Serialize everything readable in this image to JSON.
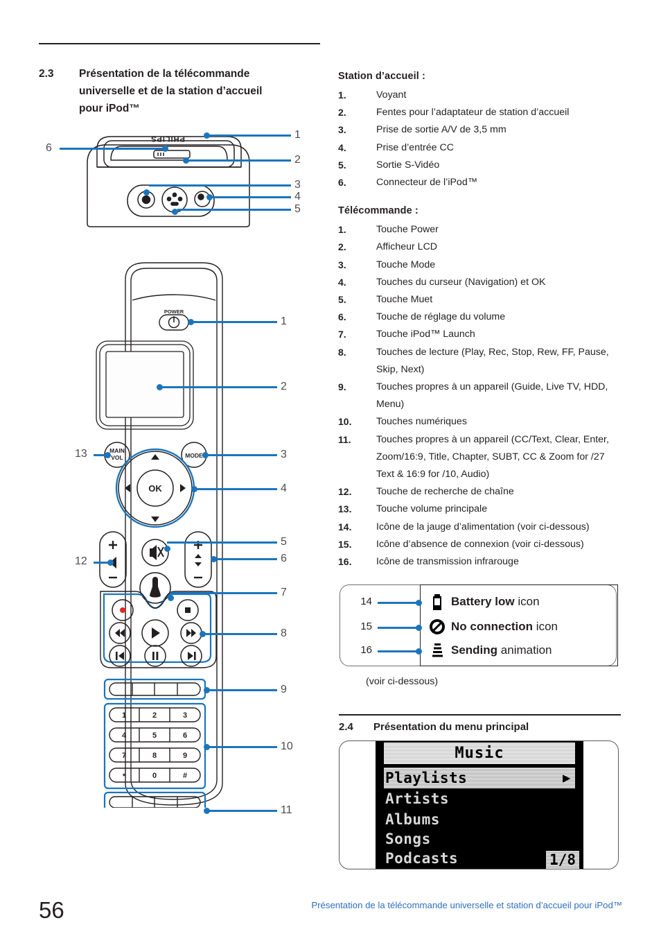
{
  "section_23": {
    "number": "2.3",
    "title_line1": "Présentation de la télécommande",
    "title_line2": "universelle et de la station d’accueil",
    "title_line3": "pour iPod™"
  },
  "dock_list": {
    "heading": "Station d’accueil :",
    "items": [
      {
        "n": "1.",
        "text": "Voyant"
      },
      {
        "n": "2.",
        "text": "Fentes pour l’adaptateur de station d’accueil"
      },
      {
        "n": "3.",
        "text": "Prise de sortie A/V de 3,5 mm"
      },
      {
        "n": "4.",
        "text": "Prise d’entrée CC"
      },
      {
        "n": "5.",
        "text": "Sortie S-Vidéo"
      },
      {
        "n": "6.",
        "text": "Connecteur de l’iPod™"
      }
    ]
  },
  "remote_list": {
    "heading": "Télécommande :",
    "items": [
      {
        "n": "1.",
        "text": "Touche Power"
      },
      {
        "n": "2.",
        "text": "Afficheur LCD"
      },
      {
        "n": "3.",
        "text": "Touche Mode"
      },
      {
        "n": "4.",
        "text": "Touches du curseur (Navigation) et OK"
      },
      {
        "n": "5.",
        "text": "Touche Muet"
      },
      {
        "n": "6.",
        "text": "Touche de réglage du volume"
      },
      {
        "n": "7.",
        "text": "Touche iPod™ Launch"
      },
      {
        "n": "8.",
        "text": "Touches de lecture (Play, Rec, Stop, Rew, FF, Pause, Skip, Next)"
      },
      {
        "n": "9.",
        "text": "Touches propres à un appareil (Guide, Live TV, HDD, Menu)"
      },
      {
        "n": "10.",
        "text": "Touches numériques"
      },
      {
        "n": "11.",
        "text": "Touches propres à un appareil (CC/Text, Clear, Enter, Zoom/16:9, Title, Chapter, SUBT, CC & Zoom for /27 Text & 16:9 for /10, Audio)"
      },
      {
        "n": "12.",
        "text": "Touche de recherche de chaîne"
      },
      {
        "n": "13.",
        "text": "Touche volume principale"
      },
      {
        "n": "14.",
        "text": "Icône de la jauge d’alimentation (voir ci-dessous)"
      },
      {
        "n": "15.",
        "text": "Icône d’absence de connexion (voir ci-dessous)"
      },
      {
        "n": "16.",
        "text": "Icône de transmission infrarouge"
      }
    ]
  },
  "legend": {
    "rows": [
      {
        "num": "14",
        "icon": "battery-low-icon",
        "bold": "Battery low",
        "rest": " icon"
      },
      {
        "num": "15",
        "icon": "no-connection-icon",
        "bold": "No connection",
        "rest": " icon"
      },
      {
        "num": "16",
        "icon": "sending-icon",
        "bold": "Sending",
        "rest": " animation"
      }
    ],
    "note": "(voir ci-dessous)"
  },
  "section_24": {
    "number": "2.4",
    "title": "Présentation du menu principal"
  },
  "lcd_screen": {
    "title": "Music",
    "rows": [
      "Playlists",
      "Artists",
      "Albums",
      "Songs",
      "Podcasts"
    ],
    "selected_index": 0,
    "selected_arrow": "▶",
    "page_indicator": "1/8"
  },
  "dock_diagram": {
    "brand": "PHILIPS",
    "callouts": [
      "1",
      "2",
      "3",
      "4",
      "5",
      "6"
    ]
  },
  "remote_diagram": {
    "power_label": "POWER",
    "main_vol_label_1": "MAIN",
    "main_vol_label_2": "VOL",
    "mode_label": "MODE",
    "ok_label": "OK",
    "keypad": [
      [
        "1",
        "2",
        "3"
      ],
      [
        "4",
        "5",
        "6"
      ],
      [
        "7",
        "8",
        "9"
      ],
      [
        "*",
        "0",
        "#"
      ]
    ],
    "callouts_right": [
      "1",
      "2",
      "3",
      "4",
      "5",
      "6",
      "7",
      "8",
      "9",
      "10",
      "11"
    ],
    "callouts_left": [
      "13",
      "12"
    ]
  },
  "footer": {
    "page_number": "56",
    "text": "Présentation de la télécommande universelle et station d’accueil pour iPod™"
  },
  "colors": {
    "accent_blue": "#1b75bc",
    "footer_blue": "#2f6fc0",
    "ink": "#231f20"
  }
}
